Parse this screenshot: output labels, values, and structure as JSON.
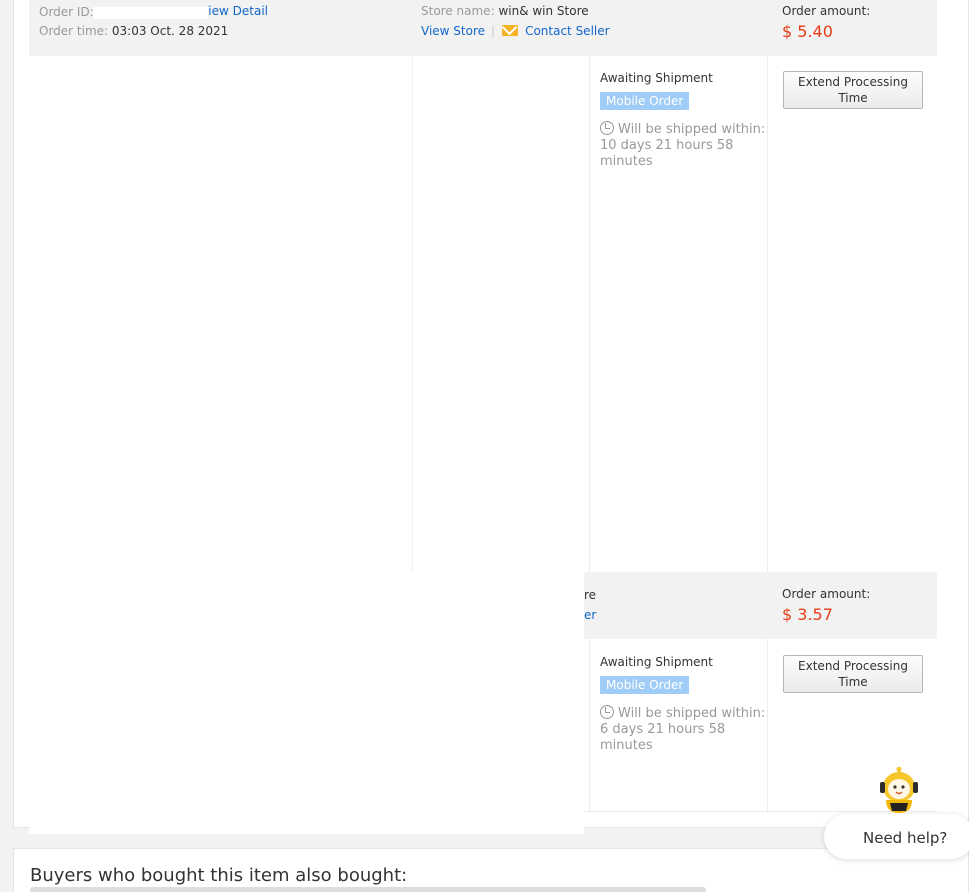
{
  "order1": {
    "order_id_label": "Order ID:",
    "view_detail_link": "View Detail",
    "order_time_label": "Order time:",
    "order_time_value": "03:03 Oct. 28 2021",
    "store_name_label": "Store name:",
    "store_name_value": "win& win Store",
    "view_store_link": "View Store",
    "separator": "|",
    "contact_seller_link": "Contact Seller",
    "amount_label": "Order amount:",
    "amount_value": "$ 5.40",
    "status": "Awaiting Shipment",
    "badge": "Mobile Order",
    "ship_text": "Will be shipped within: 10 days 21 hours 58 minutes",
    "extend_button": "Extend Processing Time"
  },
  "order2": {
    "store_label_fragment": "re",
    "contact_link_fragment": "er",
    "amount_label": "Order amount:",
    "amount_value": "$ 3.57",
    "status": "Awaiting Shipment",
    "badge": "Mobile Order",
    "ship_text": "Will be shipped within: 6 days 21 hours 58 minutes",
    "extend_button": "Extend Processing Time"
  },
  "also_bought_title": "Buyers who bought this item also bought:",
  "help": {
    "label": "Need help?",
    "icon": "robot-assistant-icon"
  },
  "colors": {
    "accent_link": "#1266c9",
    "amount": "#e63c17",
    "badge": "#9fcdf8",
    "mail": "#f5b22b"
  }
}
